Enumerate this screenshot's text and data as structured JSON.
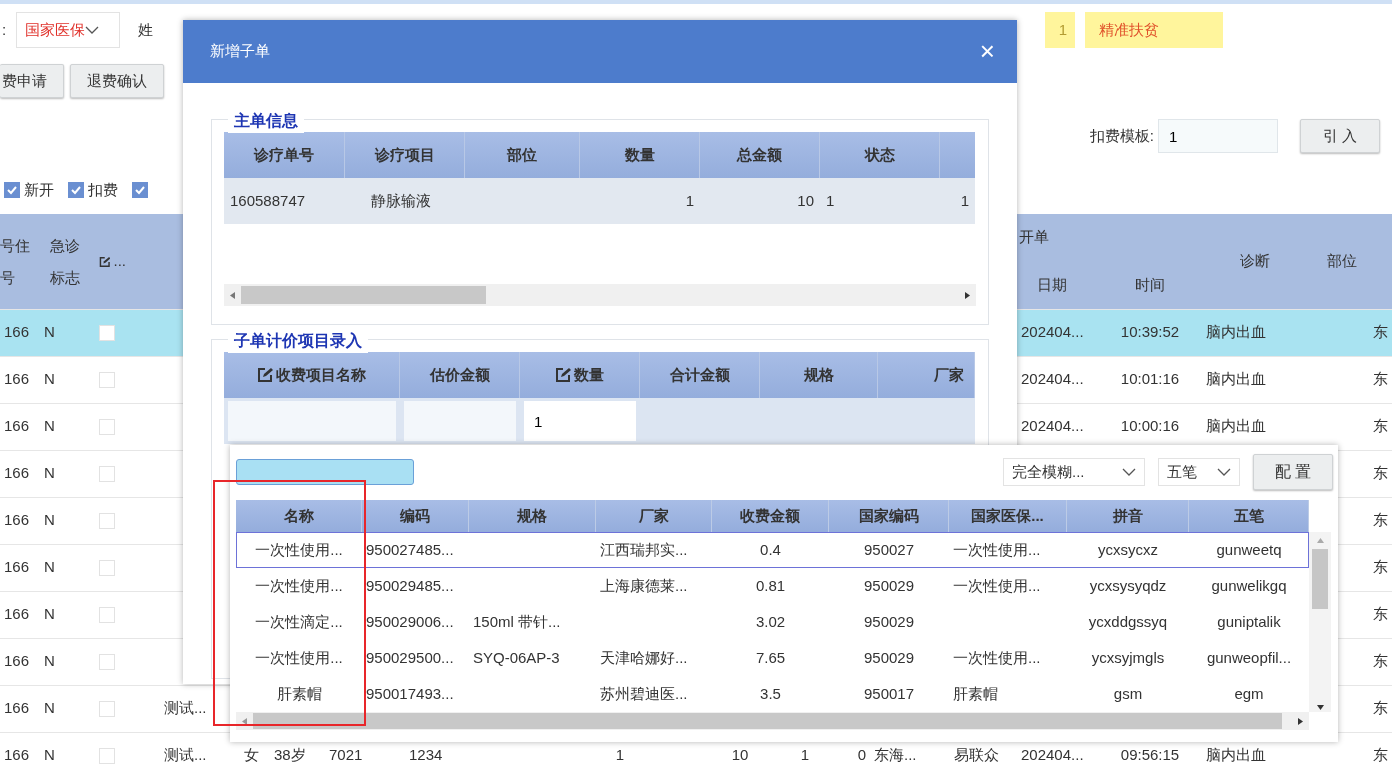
{
  "filter_bar": {
    "type_label": ":",
    "insurance_select": "国家医保",
    "name_label": "姓",
    "tags": [
      {
        "text": "1",
        "kind": "plain"
      },
      {
        "text": "精准扶贫",
        "kind": "alert"
      }
    ]
  },
  "toolbar": {
    "buttons": [
      "费申请",
      "退费确认"
    ]
  },
  "template": {
    "label": "扣费模板:",
    "value": "1",
    "button": "引 入"
  },
  "filters": [
    {
      "label": "新开",
      "checked": true
    },
    {
      "label": "扣费",
      "checked": true
    },
    {
      "checked": true
    }
  ],
  "table": {
    "headers": {
      "inpatient_no": "号住号",
      "emergency": "急诊标志",
      "check": "...",
      "group": "开单",
      "date": "日期",
      "time": "时间",
      "diagnosis": "诊断",
      "site": "部位"
    },
    "rows": [
      {
        "selected": true,
        "inpatient_no": "166",
        "emergency": "N",
        "checked": false,
        "date": "202404...",
        "time": "10:39:52",
        "diagnosis": "脑内出血",
        "column_19": "东"
      },
      {
        "selected": false,
        "inpatient_no": "166",
        "emergency": "N",
        "checked": false,
        "date": "202404...",
        "time": "10:01:16",
        "diagnosis": "脑内出血",
        "column_19": "东"
      },
      {
        "selected": false,
        "inpatient_no": "166",
        "emergency": "N",
        "checked": false,
        "date": "202404...",
        "time": "10:00:16",
        "diagnosis": "脑内出血",
        "column_19": "东"
      },
      {
        "selected": false,
        "inpatient_no": "166",
        "emergency": "N",
        "checked": false,
        "column_19": "东"
      },
      {
        "selected": false,
        "inpatient_no": "166",
        "emergency": "N",
        "checked": false,
        "column_19": "东"
      },
      {
        "selected": false,
        "inpatient_no": "166",
        "emergency": "N",
        "checked": false,
        "column_19": "东"
      },
      {
        "selected": false,
        "inpatient_no": "166",
        "emergency": "N",
        "checked": false,
        "column_19": "东"
      },
      {
        "selected": false,
        "inpatient_no": "166",
        "emergency": "N",
        "checked": false,
        "column_19": "东"
      },
      {
        "selected": false,
        "inpatient_no": "166",
        "emergency": "N",
        "checked": false,
        "name": "测试...",
        "column_19": "东"
      },
      {
        "selected": false,
        "inpatient_no": "166",
        "emergency": "N",
        "checked": false,
        "name": "测试...",
        "gender": "女",
        "age": "38岁",
        "column_7": "7021",
        "column_8": "1234",
        "column_9": "1",
        "column_10": "10",
        "column_11": "1",
        "column_12": "0",
        "column_13": "东海...",
        "column_14": "易联众",
        "date": "202404...",
        "time": "09:56:15",
        "diagnosis": "脑内出血",
        "column_19": "东"
      }
    ]
  },
  "dialog": {
    "title": "新增子单",
    "close": "×",
    "master": {
      "legend": "主单信息",
      "columns": [
        "诊疗单号",
        "诊疗项目",
        "部位",
        "数量",
        "总金额",
        "状态"
      ],
      "rows": [
        {
          "order_no": "160588747",
          "item": "静脉输液",
          "quantity": "1",
          "total": "10",
          "status": "1",
          "column_7": "1"
        }
      ]
    },
    "detail": {
      "legend": "子单计价项目录入",
      "columns": [
        {
          "label": "收费项目名称",
          "editable": true
        },
        {
          "label": "估价金额",
          "editable": false
        },
        {
          "label": "数量",
          "editable": true
        },
        {
          "label": "合计金额",
          "editable": false
        },
        {
          "label": "规格",
          "editable": false
        },
        {
          "label": "厂家",
          "editable": false
        }
      ],
      "entry": {
        "quantity": "1"
      }
    }
  },
  "popup": {
    "match_mode": "完全模糊...",
    "input_method": "五笔",
    "config_button": "配 置",
    "columns": [
      "名称",
      "编码",
      "规格",
      "厂家",
      "收费金额",
      "国家编码",
      "国家医保...",
      "拼音",
      "五笔"
    ],
    "rows": [
      {
        "selected": true,
        "name": "一次性使用...",
        "code": "950027485...",
        "maker": "江西瑞邦实...",
        "price": "0.4",
        "national_code": "950027",
        "insurance_name": "一次性使用...",
        "pinyin": "ycxsycxz",
        "wubi": "gunweetq"
      },
      {
        "selected": false,
        "name": "一次性使用...",
        "code": "950029485...",
        "maker": "上海康德莱...",
        "price": "0.81",
        "national_code": "950029",
        "insurance_name": "一次性使用...",
        "pinyin": "ycxsysyqdz",
        "wubi": "gunwelikgq"
      },
      {
        "selected": false,
        "name": "一次性滴定...",
        "code": "950029006...",
        "spec": "150ml 带针...",
        "price": "3.02",
        "national_code": "950029",
        "pinyin": "ycxddgssyq",
        "wubi": "guniptalik"
      },
      {
        "selected": false,
        "name": "一次性使用...",
        "code": "950029500...",
        "spec": "SYQ-06AP-3",
        "maker": "天津哈娜好...",
        "price": "7.65",
        "national_code": "950029",
        "insurance_name": "一次性使用...",
        "pinyin": "ycxsyjmgls",
        "wubi": "gunweopfil..."
      },
      {
        "selected": false,
        "name": "肝素帽",
        "code": "950017493...",
        "maker": "苏州碧迪医...",
        "price": "3.5",
        "national_code": "950017",
        "insurance_name": "肝素帽",
        "pinyin": "gsm",
        "wubi": "egm"
      }
    ]
  },
  "annotation": {
    "kind": "frame"
  }
}
